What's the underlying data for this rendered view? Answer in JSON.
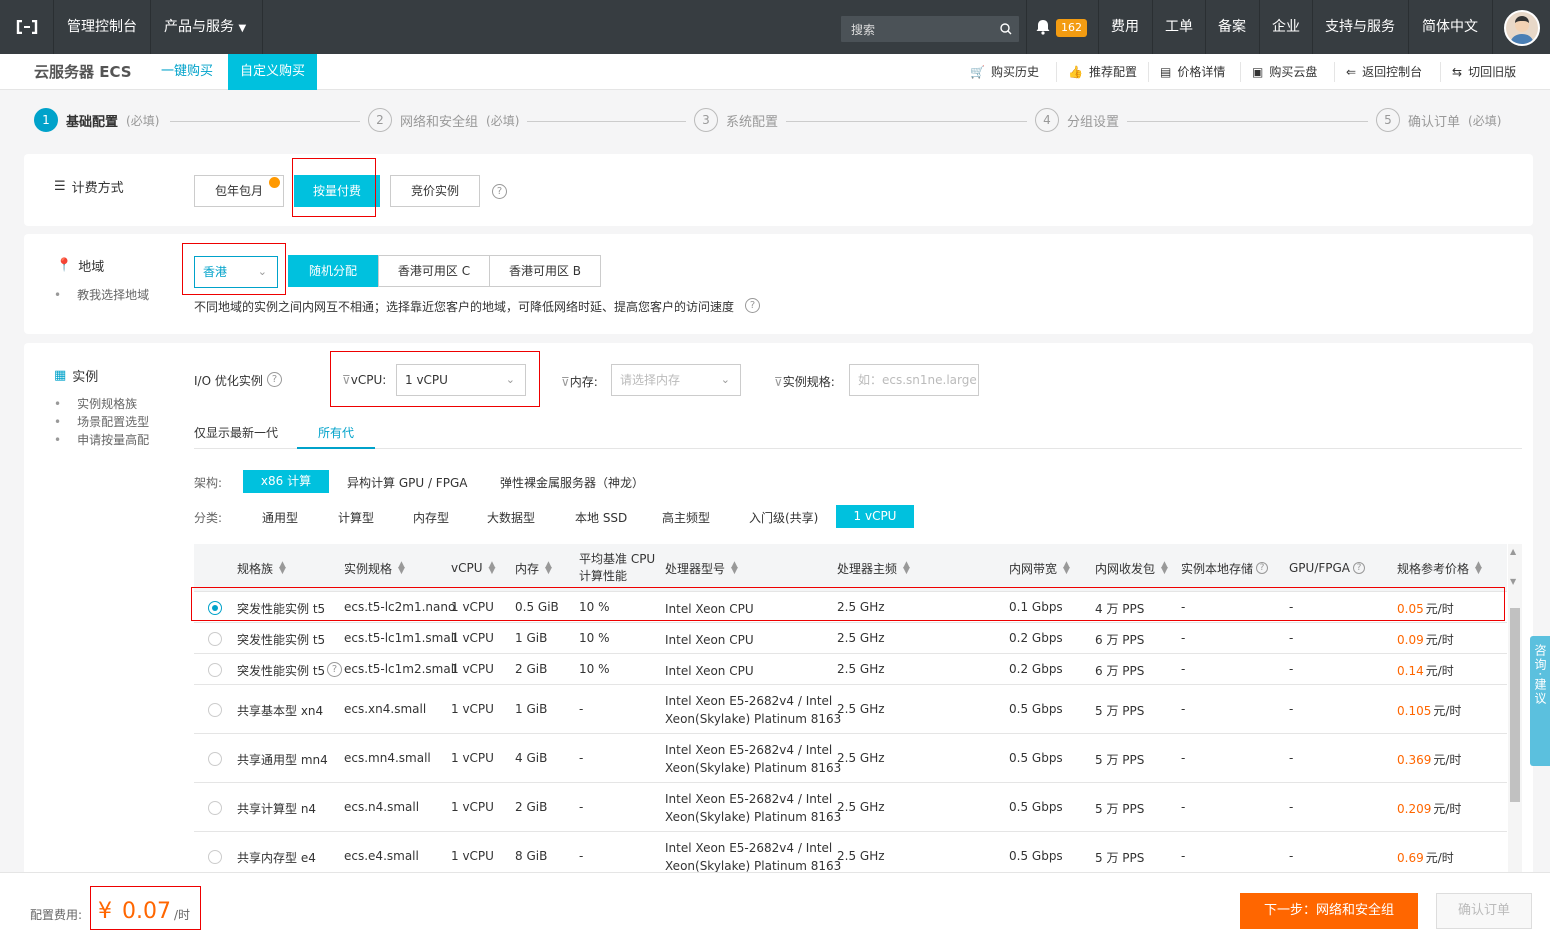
{
  "topbar": {
    "console": "管理控制台",
    "products": "产品与服务",
    "search_placeholder": "搜索",
    "badge": "162",
    "nav": [
      "费用",
      "工单",
      "备案",
      "企业",
      "支持与服务",
      "简体中文"
    ]
  },
  "subbar": {
    "title": "云服务器 ECS",
    "tab_quick": "一键购买",
    "tab_custom": "自定义购买",
    "right": [
      "购买历史",
      "推荐配置",
      "价格详情",
      "购买云盘",
      "返回控制台",
      "切回旧版"
    ]
  },
  "steps": [
    {
      "num": "1",
      "label": "基础配置",
      "req": "(必填)"
    },
    {
      "num": "2",
      "label": "网络和安全组",
      "req": "(必填)"
    },
    {
      "num": "3",
      "label": "系统配置",
      "req": ""
    },
    {
      "num": "4",
      "label": "分组设置",
      "req": ""
    },
    {
      "num": "5",
      "label": "确认订单",
      "req": "(必填)"
    }
  ],
  "billing": {
    "label": "计费方式",
    "options": [
      "包年包月",
      "按量付费",
      "竞价实例"
    ],
    "selected": "按量付费"
  },
  "region": {
    "label": "地域",
    "help_link": "教我选择地域",
    "region_value": "香港",
    "zones": [
      "随机分配",
      "香港可用区 C",
      "香港可用区 B"
    ],
    "note": "不同地域的实例之间内网互不相通；选择靠近您客户的地域，可降低网络时延、提高您客户的访问速度"
  },
  "instance": {
    "label": "实例",
    "links": [
      "实例规格族",
      "场景配置选型",
      "申请按量高配"
    ],
    "io_label": "I/O 优化实例",
    "vcpu_label": "vCPU:",
    "vcpu_value": "1 vCPU",
    "mem_label": "内存:",
    "mem_placeholder": "请选择内存",
    "spec_label": "实例规格:",
    "spec_placeholder": "如：ecs.sn1ne.large",
    "gen_tabs": [
      "仅显示最新一代",
      "所有代"
    ],
    "arch_label": "架构:",
    "arch": [
      "x86 计算",
      "异构计算 GPU / FPGA",
      "弹性裸金属服务器（神龙）"
    ],
    "cat_label": "分类:",
    "cats": [
      "通用型",
      "计算型",
      "内存型",
      "大数据型",
      "本地 SSD",
      "高主频型",
      "入门级(共享)",
      "1 vCPU"
    ]
  },
  "table": {
    "headers": [
      "规格族",
      "实例规格",
      "vCPU",
      "内存",
      "平均基准 CPU",
      "计算性能",
      "处理器型号",
      "处理器主频",
      "内网带宽",
      "内网收发包",
      "实例本地存储",
      "GPU/FPGA",
      "规格参考价格"
    ],
    "rows": [
      {
        "family": "突发性能实例 t5",
        "spec": "ecs.t5-lc2m1.nano",
        "vcpu": "1 vCPU",
        "mem": "0.5 GiB",
        "base": "10 %",
        "cpu1": "Intel Xeon CPU",
        "cpu2": "",
        "freq": "2.5 GHz",
        "bw": "0.1 Gbps",
        "pps": "4 万 PPS",
        "disk": "-",
        "gpu": "-",
        "price": "0.05",
        "unit": "元/时"
      },
      {
        "family": "突发性能实例 t5",
        "spec": "ecs.t5-lc1m1.small",
        "vcpu": "1 vCPU",
        "mem": "1 GiB",
        "base": "10 %",
        "cpu1": "Intel Xeon CPU",
        "cpu2": "",
        "freq": "2.5 GHz",
        "bw": "0.2 Gbps",
        "pps": "6 万 PPS",
        "disk": "-",
        "gpu": "-",
        "price": "0.09",
        "unit": "元/时"
      },
      {
        "family": "突发性能实例 t5",
        "spec": "ecs.t5-lc1m2.small",
        "vcpu": "1 vCPU",
        "mem": "2 GiB",
        "base": "10 %",
        "cpu1": "Intel Xeon CPU",
        "cpu2": "",
        "freq": "2.5 GHz",
        "bw": "0.2 Gbps",
        "pps": "6 万 PPS",
        "disk": "-",
        "gpu": "-",
        "price": "0.14",
        "unit": "元/时"
      },
      {
        "family": "共享基本型 xn4",
        "spec": "ecs.xn4.small",
        "vcpu": "1 vCPU",
        "mem": "1 GiB",
        "base": "-",
        "cpu1": "Intel Xeon E5-2682v4 / Intel",
        "cpu2": "Xeon(Skylake) Platinum 8163",
        "freq": "2.5 GHz",
        "bw": "0.5 Gbps",
        "pps": "5 万 PPS",
        "disk": "-",
        "gpu": "-",
        "price": "0.105",
        "unit": "元/时"
      },
      {
        "family": "共享通用型 mn4",
        "spec": "ecs.mn4.small",
        "vcpu": "1 vCPU",
        "mem": "4 GiB",
        "base": "-",
        "cpu1": "Intel Xeon E5-2682v4 / Intel",
        "cpu2": "Xeon(Skylake) Platinum 8163",
        "freq": "2.5 GHz",
        "bw": "0.5 Gbps",
        "pps": "5 万 PPS",
        "disk": "-",
        "gpu": "-",
        "price": "0.369",
        "unit": "元/时"
      },
      {
        "family": "共享计算型 n4",
        "spec": "ecs.n4.small",
        "vcpu": "1 vCPU",
        "mem": "2 GiB",
        "base": "-",
        "cpu1": "Intel Xeon E5-2682v4 / Intel",
        "cpu2": "Xeon(Skylake) Platinum 8163",
        "freq": "2.5 GHz",
        "bw": "0.5 Gbps",
        "pps": "5 万 PPS",
        "disk": "-",
        "gpu": "-",
        "price": "0.209",
        "unit": "元/时"
      },
      {
        "family": "共享内存型 e4",
        "spec": "ecs.e4.small",
        "vcpu": "1 vCPU",
        "mem": "8 GiB",
        "base": "-",
        "cpu1": "Intel Xeon E5-2682v4 / Intel",
        "cpu2": "Xeon(Skylake) Platinum 8163",
        "freq": "2.5 GHz",
        "bw": "0.5 Gbps",
        "pps": "5 万 PPS",
        "disk": "-",
        "gpu": "-",
        "price": "0.69",
        "unit": "元/时"
      }
    ]
  },
  "feedback": "咨询·建议",
  "footer": {
    "cost_label": "配置费用:",
    "currency": "¥",
    "amount": "0.07",
    "unit": "/时",
    "next": "下一步：网络和安全组",
    "confirm": "确认订单"
  }
}
